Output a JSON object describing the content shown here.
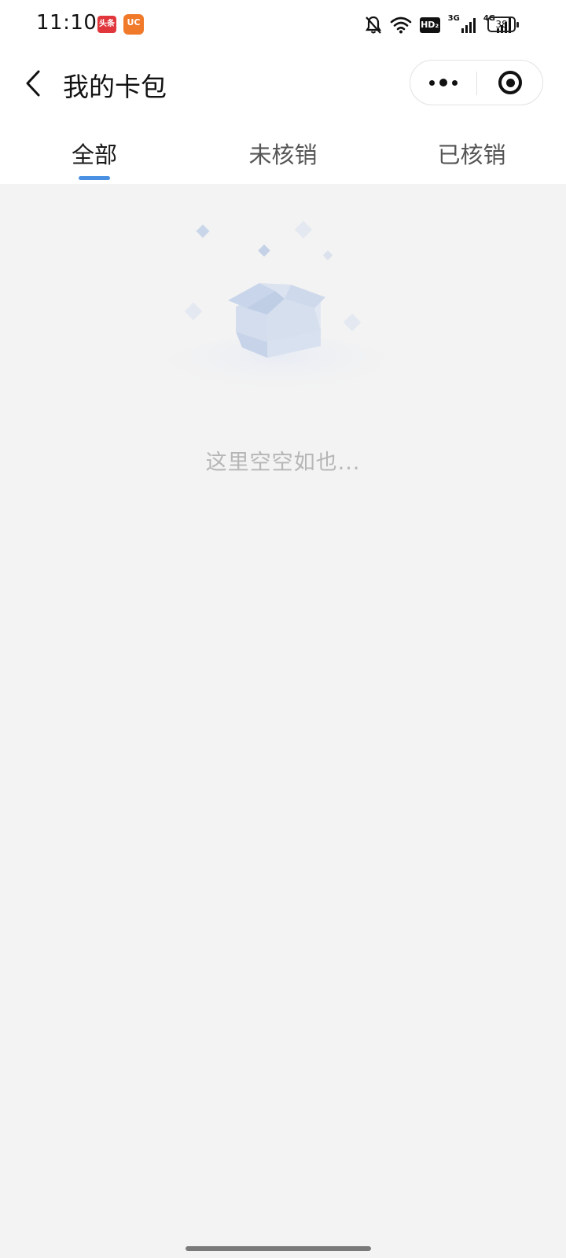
{
  "status_bar": {
    "time": "11:10",
    "toutiao_badge": "头条",
    "uc_badge": "UC",
    "hd_label": "HD₂",
    "net1_label": "3G",
    "net2_label": "4G",
    "battery": "38",
    "icons": [
      "mute-bell-icon",
      "wifi-icon",
      "hd-icon",
      "signal-3g-icon",
      "signal-4g-icon",
      "battery-icon"
    ]
  },
  "nav": {
    "title": "我的卡包",
    "back_icon": "chevron-left-icon",
    "more_icon": "more-dots-icon",
    "close_icon": "target-close-icon"
  },
  "tabs": [
    {
      "label": "全部",
      "active": true
    },
    {
      "label": "未核销",
      "active": false
    },
    {
      "label": "已核销",
      "active": false
    }
  ],
  "accent_color": "#4a90e2",
  "empty_state": {
    "message": "这里空空如也...",
    "illustration": "empty-box-illustration"
  }
}
